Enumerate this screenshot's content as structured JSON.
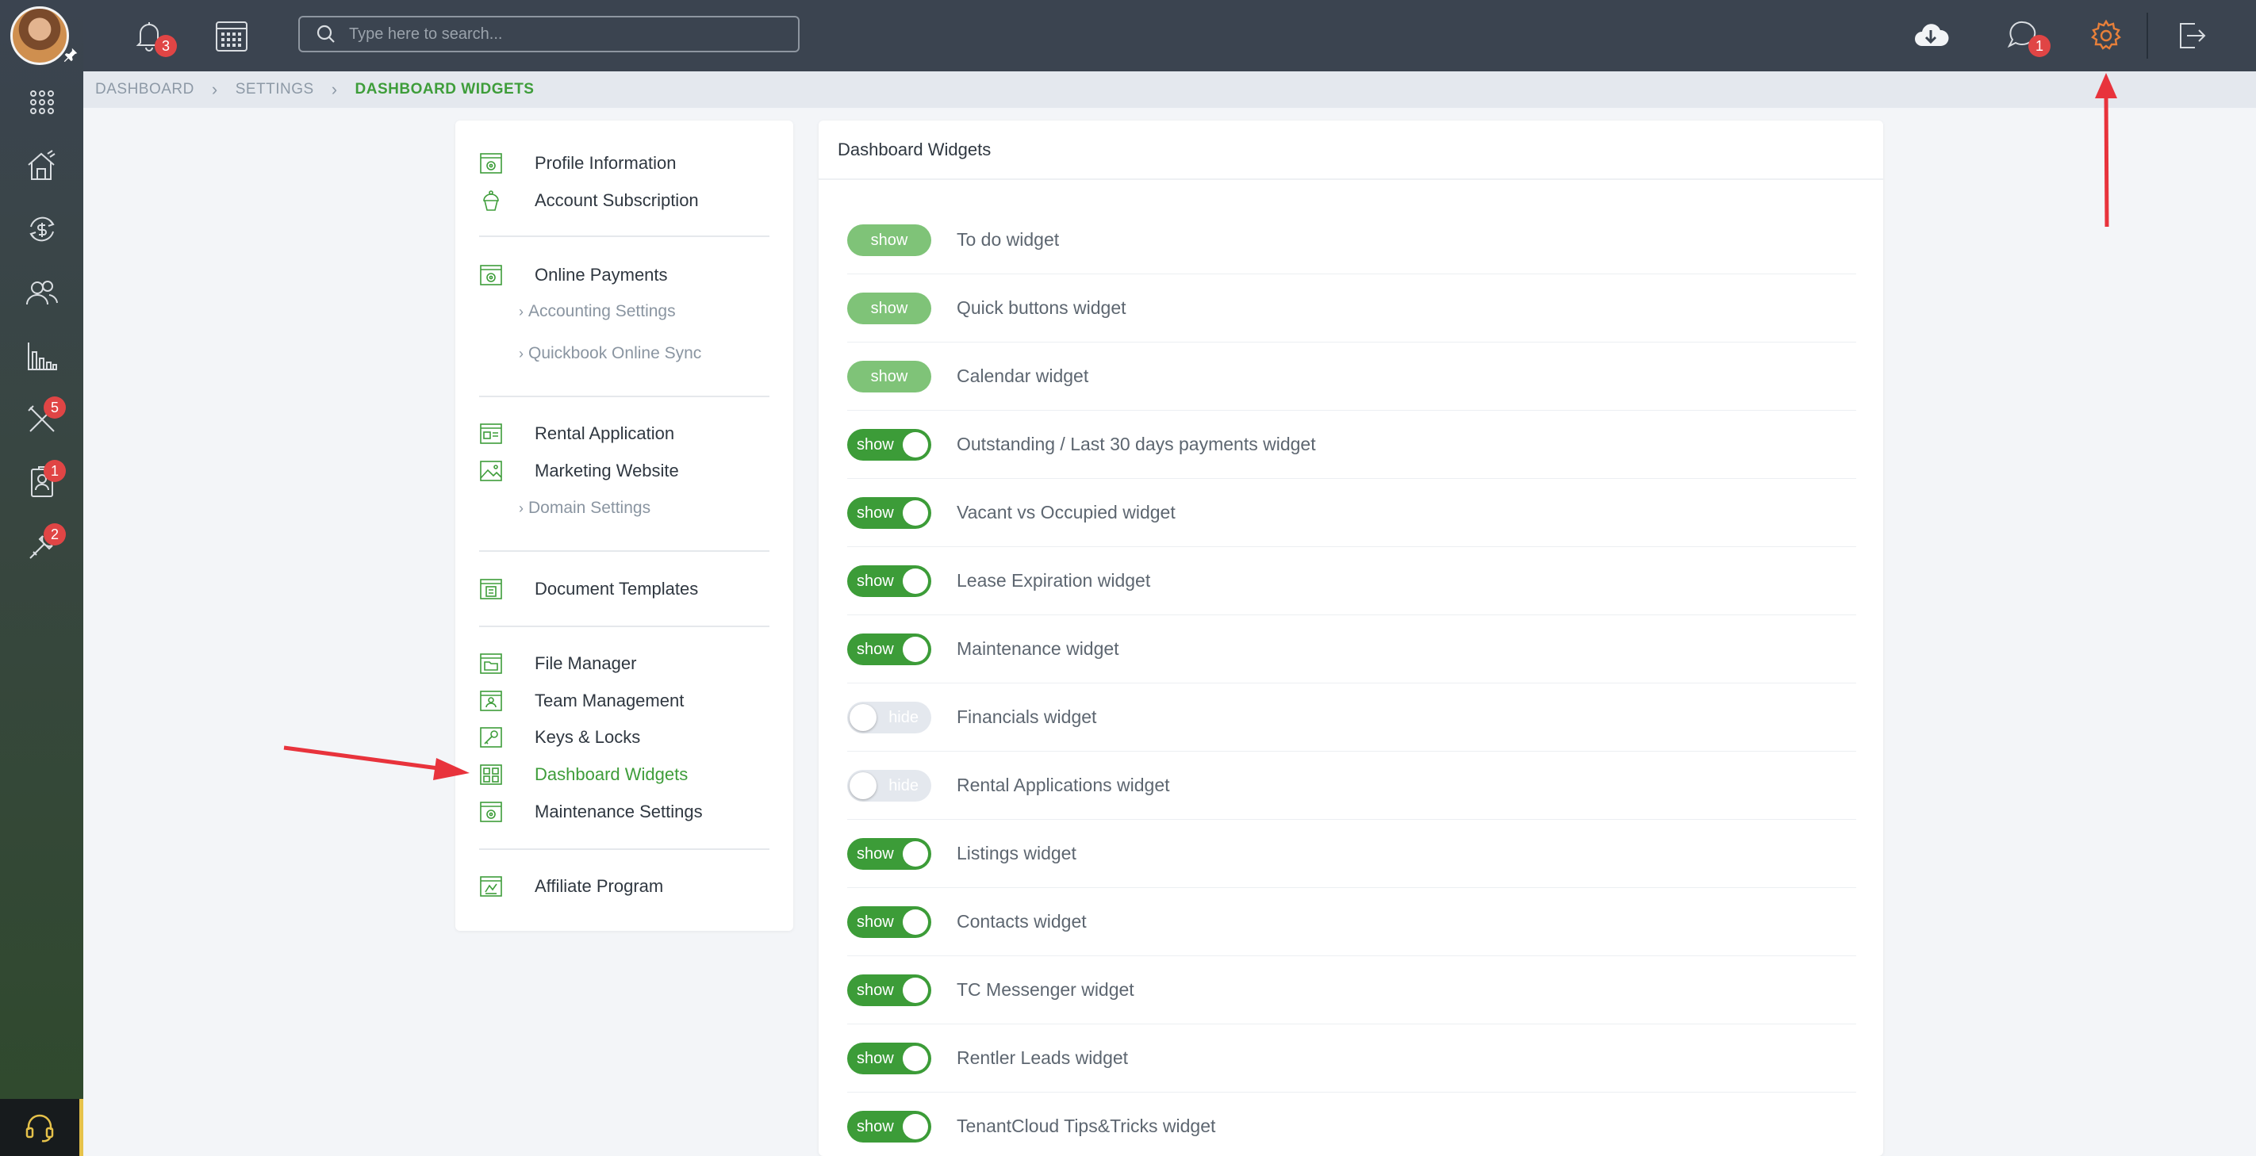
{
  "topbar": {
    "notifications_badge": "3",
    "search_placeholder": "Type here to search...",
    "messages_badge": "1"
  },
  "sidebar_badges": {
    "tools": "5",
    "tenants": "1",
    "maintenance": "2"
  },
  "breadcrumb": [
    "DASHBOARD",
    "SETTINGS",
    "DASHBOARD WIDGETS"
  ],
  "settings_menu": {
    "profile": "Profile Information",
    "subscription": "Account Subscription",
    "online_payments": "Online Payments",
    "accounting_settings": "Accounting Settings",
    "quickbook_sync": "Quickbook Online Sync",
    "rental_application": "Rental Application",
    "marketing_website": "Marketing Website",
    "domain_settings": "Domain Settings",
    "document_templates": "Document Templates",
    "file_manager": "File Manager",
    "team_management": "Team Management",
    "keys_locks": "Keys & Locks",
    "dashboard_widgets": "Dashboard Widgets",
    "maintenance_settings": "Maintenance Settings",
    "affiliate_program": "Affiliate Program"
  },
  "widgets_panel": {
    "title": "Dashboard Widgets",
    "items": [
      {
        "label": "To do widget",
        "state": "show"
      },
      {
        "label": "Quick buttons widget",
        "state": "show"
      },
      {
        "label": "Calendar widget",
        "state": "show"
      },
      {
        "label": "Outstanding / Last 30 days payments widget",
        "state": "show"
      },
      {
        "label": "Vacant vs Occupied widget",
        "state": "show"
      },
      {
        "label": "Lease Expiration widget",
        "state": "show"
      },
      {
        "label": "Maintenance widget",
        "state": "show"
      },
      {
        "label": "Financials widget",
        "state": "hide"
      },
      {
        "label": "Rental Applications widget",
        "state": "hide"
      },
      {
        "label": "Listings widget",
        "state": "show"
      },
      {
        "label": "Contacts widget",
        "state": "show"
      },
      {
        "label": "TC Messenger widget",
        "state": "show"
      },
      {
        "label": "Rentler Leads widget",
        "state": "show"
      },
      {
        "label": "TenantCloud Tips&Tricks widget",
        "state": "show"
      }
    ]
  },
  "colors": {
    "accent_green": "#3c9c38",
    "settings_icon_orange": "#e8803a",
    "badge_red": "#e04545",
    "arrow_red": "#e8333c"
  }
}
